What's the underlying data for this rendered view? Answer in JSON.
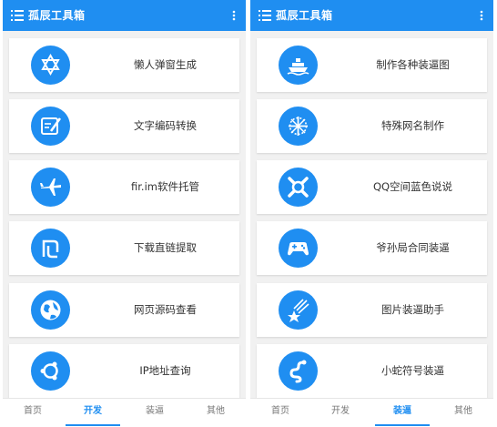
{
  "brand_color": "#1f8ef1",
  "left_panel": {
    "title": "孤辰工具箱",
    "cards": [
      {
        "label": "懒人弹窗生成",
        "icon": "star-of-david-icon"
      },
      {
        "label": "文字编码转换",
        "icon": "edit-note-icon"
      },
      {
        "label": "fir.im软件托管",
        "icon": "airplane-icon"
      },
      {
        "label": "下载直链提取",
        "icon": "shekel-icon"
      },
      {
        "label": "网页源码查看",
        "icon": "globe-icon"
      },
      {
        "label": "IP地址查询",
        "icon": "ubuntu-icon"
      }
    ],
    "tabs": [
      {
        "label": "首页",
        "active": false
      },
      {
        "label": "开发",
        "active": true
      },
      {
        "label": "装逼",
        "active": false
      },
      {
        "label": "其他",
        "active": false
      }
    ]
  },
  "right_panel": {
    "title": "孤辰工具箱",
    "cards": [
      {
        "label": "制作各种装逼图",
        "icon": "ship-icon"
      },
      {
        "label": "特殊网名制作",
        "icon": "snowflake-icon"
      },
      {
        "label": "QQ空间蓝色说说",
        "icon": "crossbones-icon"
      },
      {
        "label": "爷孙局合同装逼",
        "icon": "gamepad-icon"
      },
      {
        "label": "图片装逼助手",
        "icon": "shooting-star-icon"
      },
      {
        "label": "小蛇符号装逼",
        "icon": "snake-icon"
      }
    ],
    "tabs": [
      {
        "label": "首页",
        "active": false
      },
      {
        "label": "开发",
        "active": false
      },
      {
        "label": "装逼",
        "active": true
      },
      {
        "label": "其他",
        "active": false
      }
    ]
  }
}
